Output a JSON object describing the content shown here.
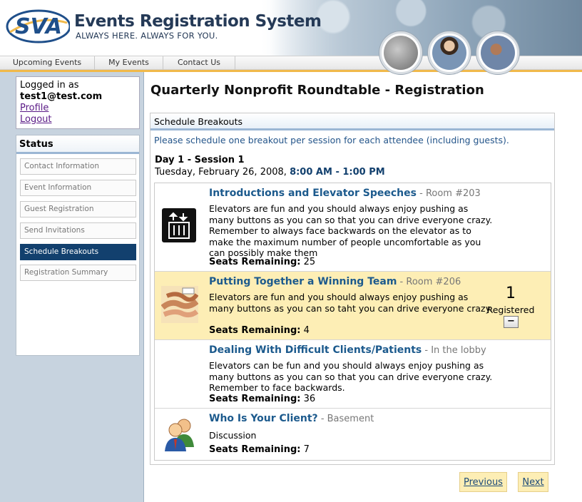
{
  "header": {
    "logo_text": "SVA",
    "title": "Events Registration System",
    "tagline": "ALWAYS HERE. ALWAYS FOR YOU."
  },
  "nav": {
    "items": [
      {
        "label": "Upcoming Events"
      },
      {
        "label": "My Events"
      },
      {
        "label": "Contact Us"
      }
    ]
  },
  "user": {
    "logged_in_label": "Logged in as",
    "email": "test1@test.com",
    "profile_link": "Profile",
    "logout_link": "Logout"
  },
  "status": {
    "heading": "Status",
    "steps": [
      {
        "label": "Contact Information"
      },
      {
        "label": "Event Information"
      },
      {
        "label": "Guest Registration"
      },
      {
        "label": "Send Invitations"
      },
      {
        "label": "Schedule Breakouts"
      },
      {
        "label": "Registration Summary"
      }
    ],
    "active_step": "Schedule Breakouts"
  },
  "main": {
    "page_title": "Quarterly Nonprofit Roundtable - Registration",
    "panel_heading": "Schedule Breakouts",
    "instructions": "Please schedule one breakout per session for each attendee (including guests).",
    "session_title": "Day 1 - Session 1",
    "session_date": "Tuesday, February 26, 2008,",
    "session_time_start": "8:00 AM",
    "session_time_sep": " - ",
    "session_time_end": "1:00 PM",
    "breakouts": [
      {
        "title": "Introductions and Elevator Speeches",
        "location": " - Room #203",
        "description": "Elevators are fun and you should always enjoy pushing as many buttons as you can so that you can drive everyone crazy. Remember to always face backwards on the elevator as to make the maximum number of people uncomfortable as you can possibly make them",
        "seats_label": "Seats Remaining:",
        "seats": "25",
        "icon": "elevator-icon"
      },
      {
        "title": "Putting Together a Winning Team",
        "location": " - Room #206",
        "description": "Elevators are fun and you should always enjoy pushing as many buttons as you can so taht you can drive everyone crazy.",
        "seats_label": "Seats Remaining:",
        "seats": "4",
        "icon": "teamwork-hands-icon",
        "registered_count": "1",
        "registered_label": "Registered",
        "remove_label": "−"
      },
      {
        "title": "Dealing With Difficult Clients/Patients",
        "location": " - In the lobby",
        "description": "Elevators can be fun and you should always enjoy pushing as many buttons as you can so that you can drive everyone crazy. Remember to face backwards.",
        "seats_label": "Seats Remaining:",
        "seats": "36",
        "icon": ""
      },
      {
        "title": "Who Is Your Client?",
        "location": " - Basement",
        "description": "Discussion",
        "seats_label": "Seats Remaining:",
        "seats": "7",
        "icon": "users-icon"
      }
    ],
    "previous_label": "Previous",
    "next_label": "Next"
  },
  "colors": {
    "accent": "#12406e",
    "title_blue": "#1c5a8d",
    "selected_row": "#fdeeb5",
    "nav_stripe": "#f1b94a"
  }
}
